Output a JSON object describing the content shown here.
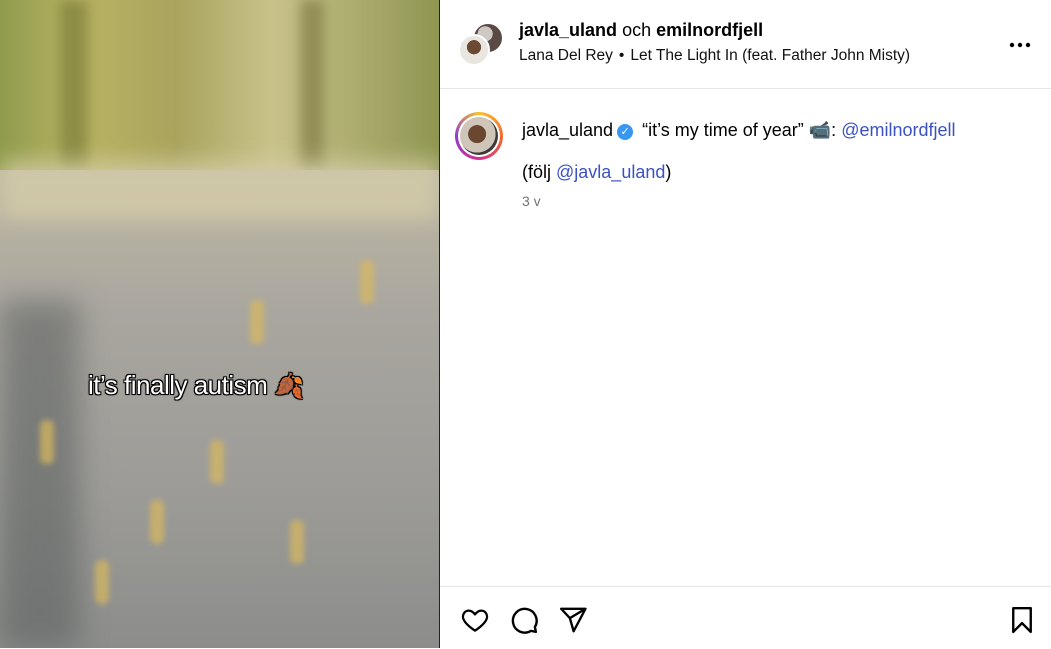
{
  "media": {
    "overlay_text": "it’s finally autism",
    "overlay_emoji": "🍂"
  },
  "header": {
    "user1": "javla_uland",
    "conjunction": "och",
    "user2": "emilnordfjell",
    "artist": "Lana Del Rey",
    "separator": "•",
    "song": "Let The Light In (feat. Father John Misty)",
    "more_icon": "more-horizontal-icon"
  },
  "post": {
    "username": "javla_uland",
    "verified_icon": "verified-badge-icon",
    "caption_text": " “it’s my time of year” 📹: ",
    "caption_mention": "@emilnordfjell",
    "line2_prefix": "(följ ",
    "line2_mention": "@javla_uland",
    "line2_suffix": ")",
    "time": "3 v"
  },
  "actions": {
    "like_icon": "heart-icon",
    "comment_icon": "comment-icon",
    "share_icon": "share-icon",
    "save_icon": "bookmark-icon"
  },
  "colors": {
    "mention": "#3b52c4",
    "verified": "#3897f0",
    "muted": "#737373"
  }
}
